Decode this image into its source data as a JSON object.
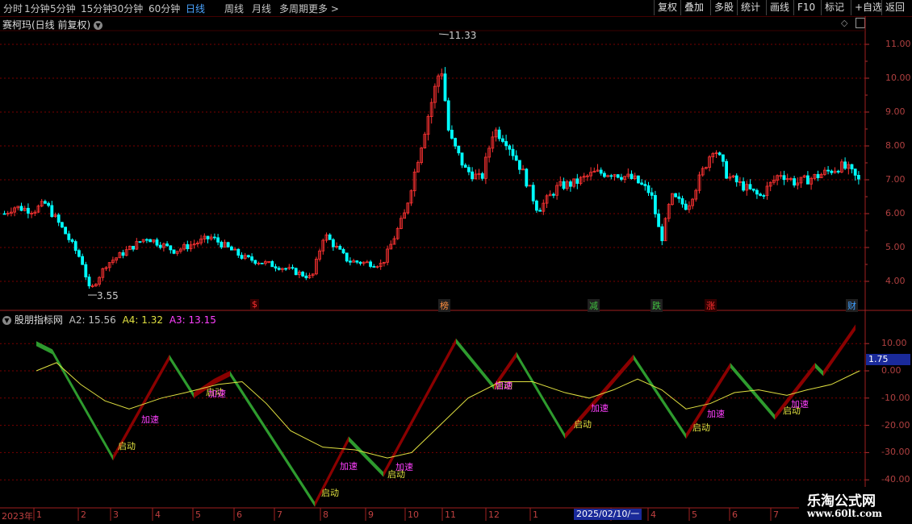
{
  "toolbar": {
    "periods": [
      "分时",
      "1分钟",
      "5分钟",
      "15分钟",
      "30分钟",
      "60分钟",
      "日线",
      "周线",
      "月线",
      "多周期",
      "更多 >"
    ],
    "active_period": "日线",
    "right_buttons": [
      "复权",
      "叠加",
      "多股",
      "统计",
      "画线",
      "F10",
      "标记",
      "+自选",
      "返回"
    ]
  },
  "main_chart": {
    "title": "赛柯玛(日线 前复权)",
    "high_label": "11.33",
    "low_label": "3.55",
    "y_ticks": [
      "11.00",
      "10.00",
      "9.00",
      "8.00",
      "7.00",
      "6.00",
      "5.00",
      "4.00"
    ],
    "event_tags": [
      {
        "text": "$",
        "color": "#ff3030"
      },
      {
        "text": "榜",
        "color": "#ff9040"
      },
      {
        "text": "减",
        "color": "#40c040"
      },
      {
        "text": "跌",
        "color": "#40c040"
      },
      {
        "text": "涨",
        "color": "#ff3030"
      },
      {
        "text": "财",
        "color": "#40a0ff"
      }
    ],
    "colors": {
      "up": "#ff3333",
      "down": "#00ffff",
      "grid": "#7a0000"
    }
  },
  "indicator": {
    "name": "股朋指标网",
    "a2_label": "A2: 15.56",
    "a4_label": "A4: 1.32",
    "a3_label": "A3: 13.15",
    "current_value": "1.75",
    "y_ticks": [
      "10.00",
      "0.00",
      "-10.00",
      "-20.00",
      "-30.00",
      "-40.00"
    ],
    "signal_start": "启动",
    "signal_accel": "加速",
    "colors": {
      "rise": "#8b0000",
      "fall": "#2e9b2e",
      "line": "#e0e040",
      "a4": "#e0e040",
      "a3": "#ff40ff",
      "a2": "#c0c0c0"
    }
  },
  "date_axis": {
    "year_label": "2023年",
    "months": [
      "1",
      "2",
      "3",
      "4",
      "5",
      "6",
      "7",
      "8",
      "9",
      "10",
      "11",
      "12",
      "1",
      "2",
      "3",
      "4",
      "5",
      "6",
      "7"
    ],
    "cursor_date": "2025/02/10/一"
  },
  "watermark": {
    "line1": "乐淘公式网",
    "line2": "www.60lt.com"
  }
}
